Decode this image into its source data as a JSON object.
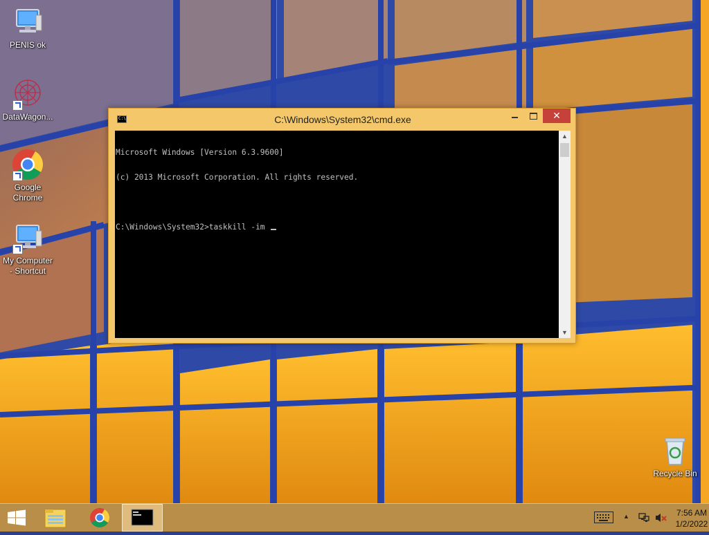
{
  "desktop": {
    "icons": [
      {
        "label": "PENIS ok",
        "icon": "computer-icon"
      },
      {
        "label": "DataWagon...",
        "icon": "datawagon-icon"
      },
      {
        "label_line1": "Google",
        "label_line2": "Chrome",
        "icon": "chrome-icon"
      },
      {
        "label_line1": "My Computer",
        "label_line2": "- Shortcut",
        "icon": "computer-icon"
      },
      {
        "label": "Recycle Bin",
        "icon": "recycle-bin-icon"
      }
    ]
  },
  "cmd_window": {
    "title": "C:\\Windows\\System32\\cmd.exe",
    "close_glyph": "✕",
    "console_lines": [
      "Microsoft Windows [Version 6.3.9600]",
      "(c) 2013 Microsoft Corporation. All rights reserved.",
      "",
      "C:\\Windows\\System32>taskkill -im "
    ],
    "icon_text": "C:\\",
    "scroll_up_glyph": "▲",
    "scroll_down_glyph": "▼"
  },
  "taskbar": {
    "start_icon": "windows-logo-icon",
    "pinned": [
      "file-explorer-icon",
      "chrome-icon",
      "cmd-icon"
    ],
    "tray_arrow": "▲",
    "clock": {
      "time": "7:56 AM",
      "date": "1/2/2022"
    }
  },
  "colors": {
    "accent_orange": "#f4c86a",
    "close_red": "#c7413b",
    "console_bg": "#000000",
    "console_fg": "#c0c0c0"
  }
}
